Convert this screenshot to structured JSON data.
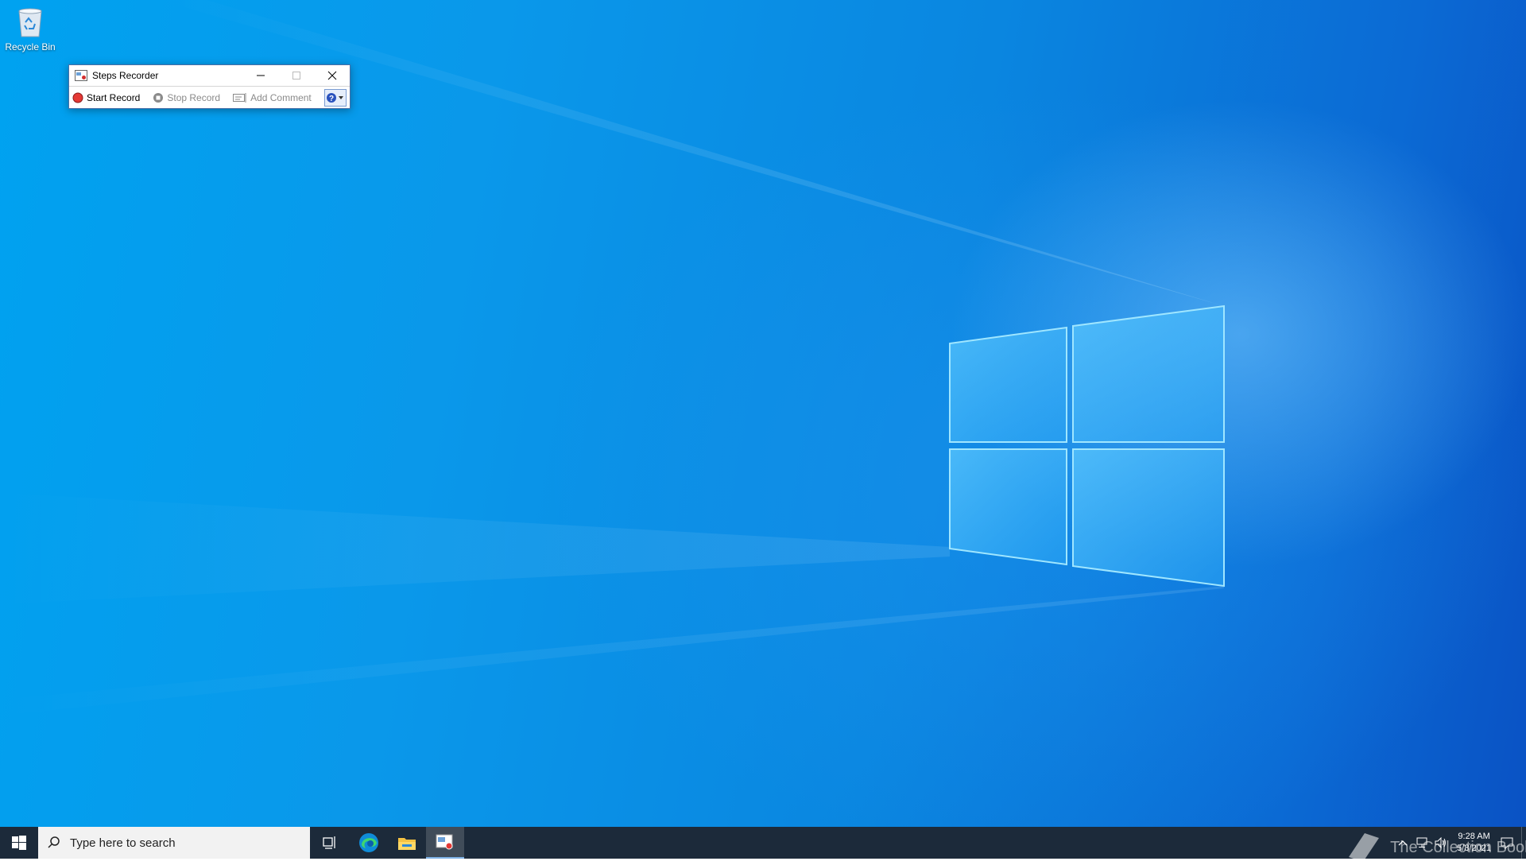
{
  "desktop": {
    "icons": [
      {
        "label": "Recycle Bin",
        "icon": "recycle-bin-icon"
      }
    ]
  },
  "steps_recorder": {
    "title": "Steps Recorder",
    "toolbar": {
      "start_record": "Start Record",
      "stop_record": "Stop Record",
      "add_comment": "Add Comment"
    },
    "window_buttons": [
      "minimize",
      "maximize",
      "close"
    ]
  },
  "taskbar": {
    "search_placeholder": "Type here to search",
    "pinned": [
      "task-view-icon",
      "edge-icon",
      "file-explorer-icon",
      "steps-recorder-icon"
    ],
    "clock": {
      "time": "9:28 AM",
      "date": "5/8/2021"
    },
    "watermark": "The Collection Book"
  },
  "colors": {
    "taskbar": "#1c2a3a",
    "record_red": "#e53935",
    "accent": "#0078d7"
  }
}
